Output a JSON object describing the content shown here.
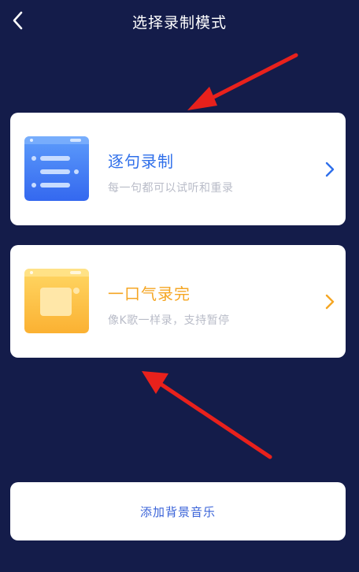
{
  "header": {
    "back_icon": "chevron-left-icon",
    "title": "选择录制模式"
  },
  "modes": [
    {
      "title": "逐句录制",
      "subtitle": "每一句都可以试听和重录",
      "icon": "document-list-icon",
      "accent": "#2f6fea"
    },
    {
      "title": "一口气录完",
      "subtitle": "像K歌一样录，支持暂停",
      "icon": "single-take-icon",
      "accent": "#f5a623"
    }
  ],
  "bottom_button": {
    "label": "添加背景音乐"
  },
  "colors": {
    "background": "#141c4a",
    "annotation_arrow": "#e8211c"
  }
}
